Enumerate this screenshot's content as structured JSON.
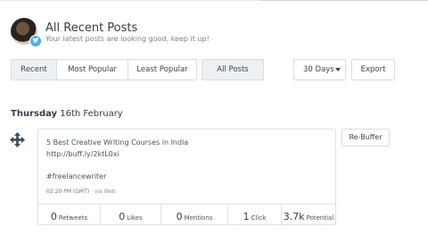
{
  "header": {
    "title": "All Recent Posts",
    "subtitle": "Your latest posts are looking good, keep it up!",
    "avatar_icon": "user-avatar",
    "badge_icon": "twitter-bird-icon",
    "badge_color": "#55acee"
  },
  "sort_tabs": [
    {
      "label": "Recent",
      "active": true
    },
    {
      "label": "Most Popular",
      "active": false
    },
    {
      "label": "Least Popular",
      "active": false
    }
  ],
  "filter": {
    "label": "All Posts"
  },
  "range": {
    "label": "30 Days",
    "icon": "caret-down-icon"
  },
  "export": {
    "label": "Export"
  },
  "day_group": {
    "weekday": "Thursday",
    "date": "16th February"
  },
  "post": {
    "text": "5 Best Creative Writing Courses in India\nhttp://buff.ly/2ktL0xi\n\n#freelancewriter",
    "time": "02:20 PM (GMT)",
    "via": "via Web",
    "drag_icon": "move-arrows-icon",
    "rebuffer_label": "Re-Buffer",
    "stats": [
      {
        "value": "0",
        "label": "Retweets"
      },
      {
        "value": "0",
        "label": "Likes"
      },
      {
        "value": "0",
        "label": "Mentions"
      },
      {
        "value": "1",
        "label": "Click"
      },
      {
        "value": "3.7k",
        "label": "Potential"
      }
    ]
  }
}
